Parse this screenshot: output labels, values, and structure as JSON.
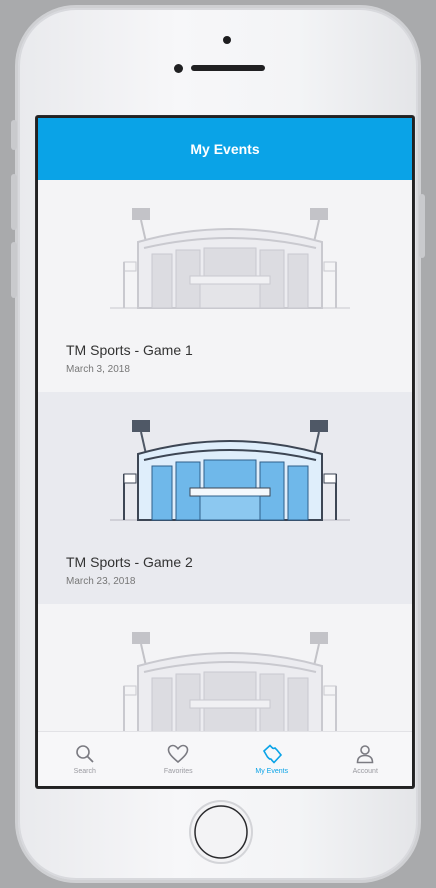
{
  "header": {
    "title": "My Events"
  },
  "events": [
    {
      "title": "TM Sports - Game 1",
      "date": "March 3, 2018"
    },
    {
      "title": "TM Sports - Game 2",
      "date": "March 23, 2018"
    },
    {
      "title": "",
      "date": ""
    }
  ],
  "tabs": [
    {
      "label": "Search",
      "icon": "search-icon"
    },
    {
      "label": "Favorites",
      "icon": "heart-icon"
    },
    {
      "label": "My Events",
      "icon": "ticket-icon"
    },
    {
      "label": "Account",
      "icon": "person-icon"
    }
  ],
  "colors": {
    "accent": "#0aa3e7",
    "stadium_glass": "#6fb8ea",
    "stadium_gray": "#c9c9cf"
  }
}
